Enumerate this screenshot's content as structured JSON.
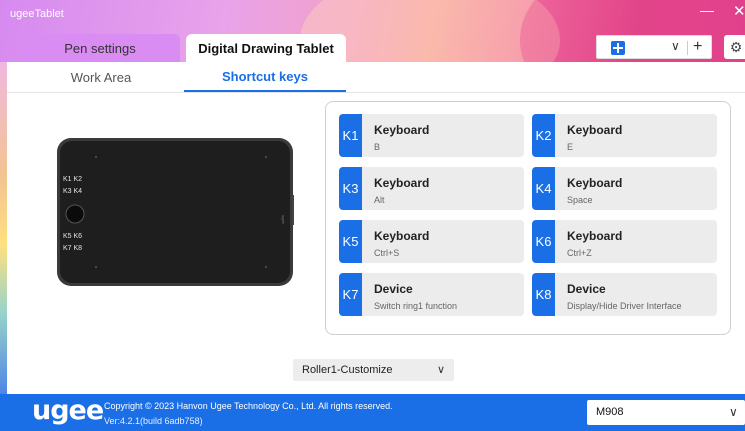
{
  "window": {
    "title": "ugeeTablet",
    "minimize_glyph": "—",
    "close_glyph": "✕"
  },
  "main_tabs": [
    {
      "label": "Pen settings",
      "active": false
    },
    {
      "label": "Digital Drawing Tablet",
      "active": true
    }
  ],
  "app_selector": {
    "icon": "app-grid-icon",
    "chevron": "∨",
    "add_glyph": "+"
  },
  "settings_icon": "⚙",
  "sub_tabs": [
    {
      "label": "Work Area",
      "active": false
    },
    {
      "label": "Shortcut keys",
      "active": true
    }
  ],
  "tablet": {
    "key_labels": [
      "K1 K2",
      "K3 K4",
      "K5 K6",
      "K7 K8"
    ],
    "brand_text": "ugee"
  },
  "shortcut_keys": [
    {
      "id": "K1",
      "type": "Keyboard",
      "value": "B"
    },
    {
      "id": "K2",
      "type": "Keyboard",
      "value": "E"
    },
    {
      "id": "K3",
      "type": "Keyboard",
      "value": "Alt"
    },
    {
      "id": "K4",
      "type": "Keyboard",
      "value": "Space"
    },
    {
      "id": "K5",
      "type": "Keyboard",
      "value": "Ctrl+S"
    },
    {
      "id": "K6",
      "type": "Keyboard",
      "value": "Ctrl+Z"
    },
    {
      "id": "K7",
      "type": "Device",
      "value": "Switch ring1 function"
    },
    {
      "id": "K8",
      "type": "Device",
      "value": "Display/Hide Driver Interface"
    }
  ],
  "roller": {
    "selected": "Roller1-Customize",
    "chevron": "∨"
  },
  "footer": {
    "logo": "ugee",
    "copyright": "Copyright © 2023 Hanvon Ugee Technology Co., Ltd. All rights reserved.",
    "version": "Ver:4.2.1(build 6adb758)",
    "device": "M908",
    "chevron": "∨"
  },
  "colors": {
    "accent": "#1a6fe6",
    "tab_pen": "#d98cf2",
    "key_bg": "#ececec"
  }
}
